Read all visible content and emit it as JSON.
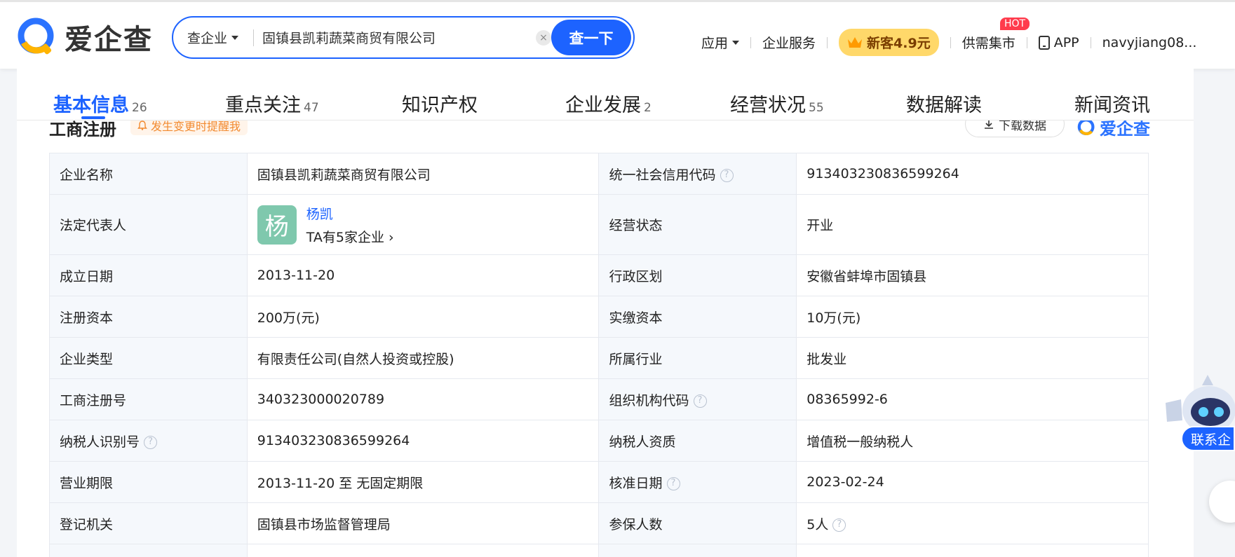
{
  "header": {
    "logo_text": "爱企查",
    "search": {
      "type_label": "查企业",
      "value": "固镇县凯莉蔬菜商贸有限公司",
      "clear": "×",
      "button": "查一下"
    },
    "nav": {
      "apps": "应用",
      "service": "企业服务",
      "promo": "新客4.9元",
      "market": "供需集市",
      "hot_badge": "HOT",
      "app": "APP",
      "user": "navyjiang08..."
    }
  },
  "tabs": [
    {
      "label": "基本信息",
      "count": "26"
    },
    {
      "label": "重点关注",
      "count": "47"
    },
    {
      "label": "知识产权",
      "count": ""
    },
    {
      "label": "企业发展",
      "count": "2"
    },
    {
      "label": "经营状况",
      "count": "55"
    },
    {
      "label": "数据解读",
      "count": ""
    },
    {
      "label": "新闻资讯",
      "count": ""
    }
  ],
  "section": {
    "title": "工商注册",
    "remind": "发生变更时提醒我",
    "download": "下载数据",
    "watermark": "爱企查"
  },
  "info": {
    "r1": {
      "k1": "企业名称",
      "v1": "固镇县凯莉蔬菜商贸有限公司",
      "k2": "统一社会信用代码",
      "v2": "913403230836599264"
    },
    "r2": {
      "k1": "法定代表人",
      "avatar": "杨",
      "person": "杨凯",
      "person_count": "TA有5家企业",
      "k2": "经营状态",
      "v2": "开业"
    },
    "r3": {
      "k1": "成立日期",
      "v1": "2013-11-20",
      "k2": "行政区划",
      "v2": "安徽省蚌埠市固镇县"
    },
    "r4": {
      "k1": "注册资本",
      "v1": "200万(元)",
      "k2": "实缴资本",
      "v2": "10万(元)"
    },
    "r5": {
      "k1": "企业类型",
      "v1": "有限责任公司(自然人投资或控股)",
      "k2": "所属行业",
      "v2": "批发业"
    },
    "r6": {
      "k1": "工商注册号",
      "v1": "340323000020789",
      "k2": "组织机构代码",
      "v2": "08365992-6"
    },
    "r7": {
      "k1": "纳税人识别号",
      "v1": "913403230836599264",
      "k2": "纳税人资质",
      "v2": "增值税一般纳税人"
    },
    "r8": {
      "k1": "营业期限",
      "v1": "2013-11-20 至 无固定期限",
      "k2": "核准日期",
      "v2": "2023-02-24"
    },
    "r9": {
      "k1": "登记机关",
      "v1": "固镇县市场监督管理局",
      "k2": "参保人数",
      "v2": "5人"
    }
  },
  "float": {
    "contact": "联系企"
  },
  "colors": {
    "brand": "#1d63ff",
    "orange": "#f28a30",
    "avatar": "#7fc8ad",
    "promo": "#ffd86a",
    "hot": "#ff3b4c"
  }
}
